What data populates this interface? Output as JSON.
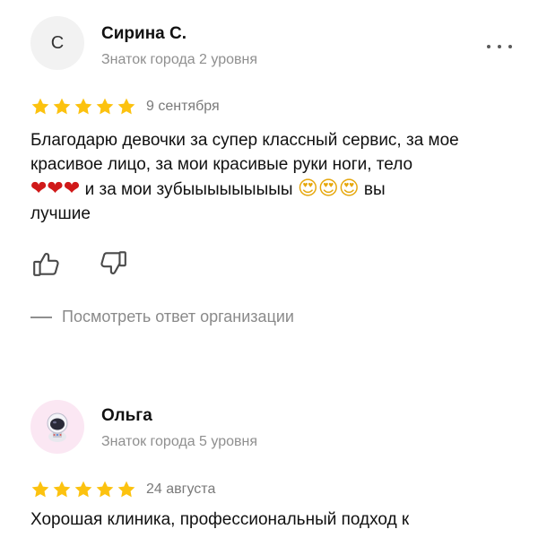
{
  "reviews": [
    {
      "author": {
        "initial": "С",
        "name": "Сирина С.",
        "level": "Знаток города 2 уровня"
      },
      "rating": 5,
      "date": "9 сентября",
      "text": {
        "line1": "Благодарю девочки за супер классный сервис, за мое",
        "line2": "красивое лицо, за мои красивые руки ноги, тело",
        "hearts": "❤❤❤",
        "line3": " и за мои зубыыыыыыыыы ",
        "smileys": "😍😍😍",
        "line3_end": " вы",
        "line4": "лучшие"
      },
      "org_reply_label": "Посмотреть ответ организации"
    },
    {
      "author": {
        "avatar_icon": "astronaut-icon",
        "name": "Ольга",
        "level": "Знаток города 5 уровня"
      },
      "rating": 5,
      "date": "24 августа",
      "text": {
        "line1": "Хорошая клиника, профессиональный подход к"
      }
    }
  ],
  "colors": {
    "star": "#fcc20f",
    "name": "#111111",
    "muted": "#8f8f8f"
  }
}
